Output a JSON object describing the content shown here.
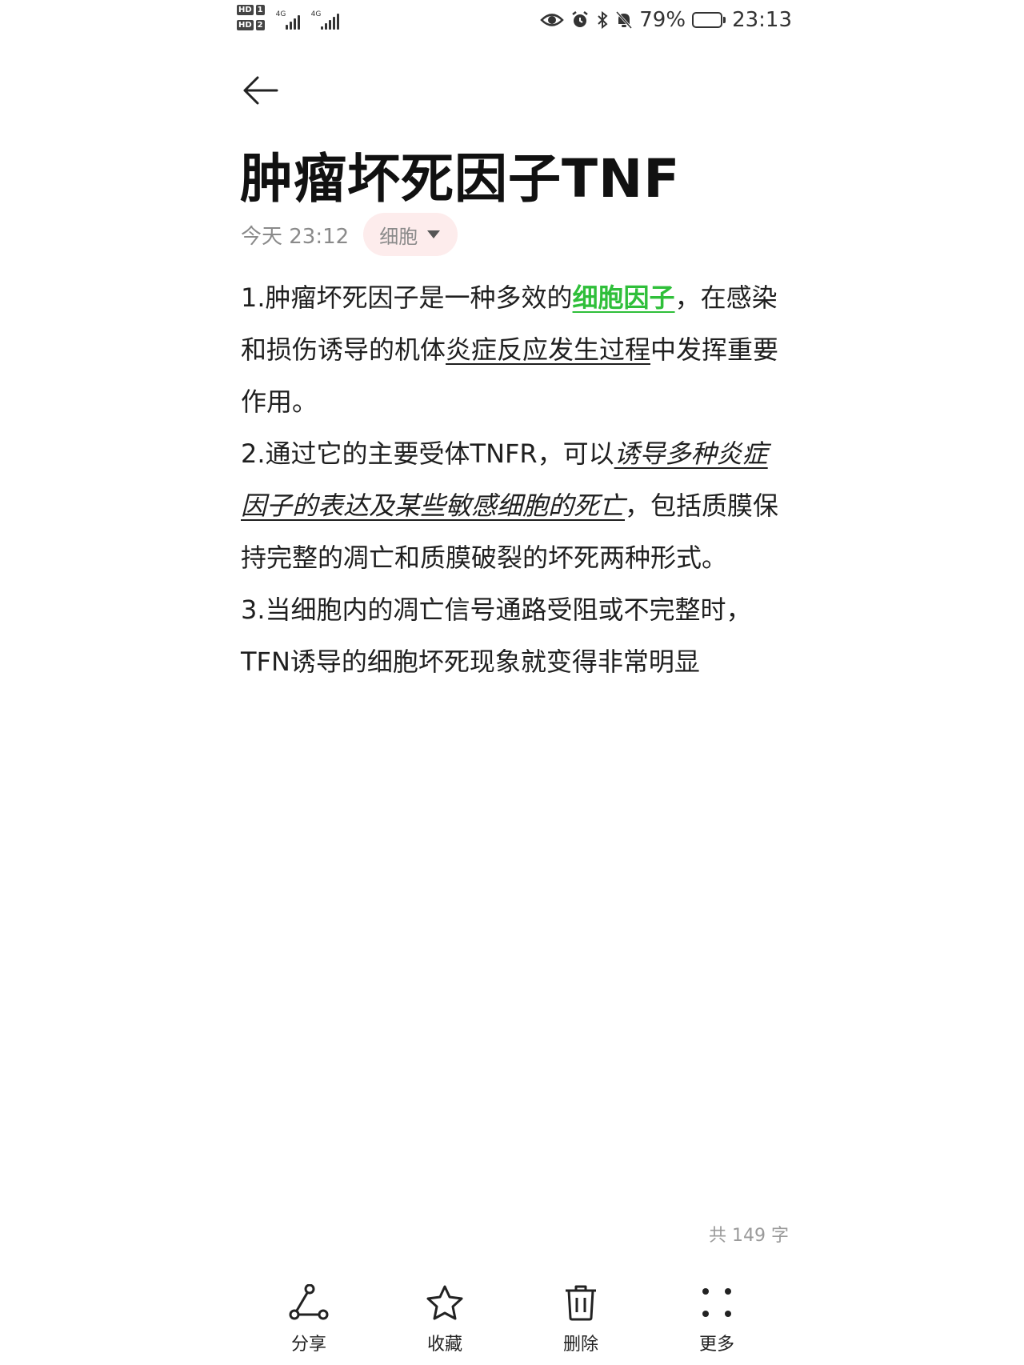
{
  "status_bar": {
    "sim1_label": "HD",
    "sim1_num": "1",
    "sim2_label": "HD",
    "sim2_num": "2",
    "network1": "4G",
    "network2": "4G",
    "battery_percent": "79%",
    "battery_level": 0.79,
    "time": "23:13"
  },
  "note": {
    "title": "肿瘤坏死因子TNF",
    "timestamp": "今天 23:12",
    "category": "细胞",
    "p1": {
      "a": "1.肿瘤坏死因子是一种多效的",
      "b": "细胞因子",
      "c": "，在感染和损伤诱导的机体",
      "d": "炎症反应发生过程",
      "e": "中发挥重要作用。"
    },
    "p2": {
      "a": "2.通过它的主要受体TNFR，可以",
      "b": "诱导多种炎症因子的表达及某些敏感细胞的死亡",
      "c": "，包括质膜保持完整的凋亡和质膜破裂的坏死两种形式。"
    },
    "p3": "3.当细胞内的凋亡信号通路受阻或不完整时，TFN诱导的细胞坏死现象就变得非常明显",
    "word_count": "共 149 字"
  },
  "toolbar": {
    "share": "分享",
    "favorite": "收藏",
    "delete": "删除",
    "more": "更多"
  },
  "colors": {
    "highlight_green": "#2fbf3a",
    "chip_bg": "#fdecec"
  }
}
